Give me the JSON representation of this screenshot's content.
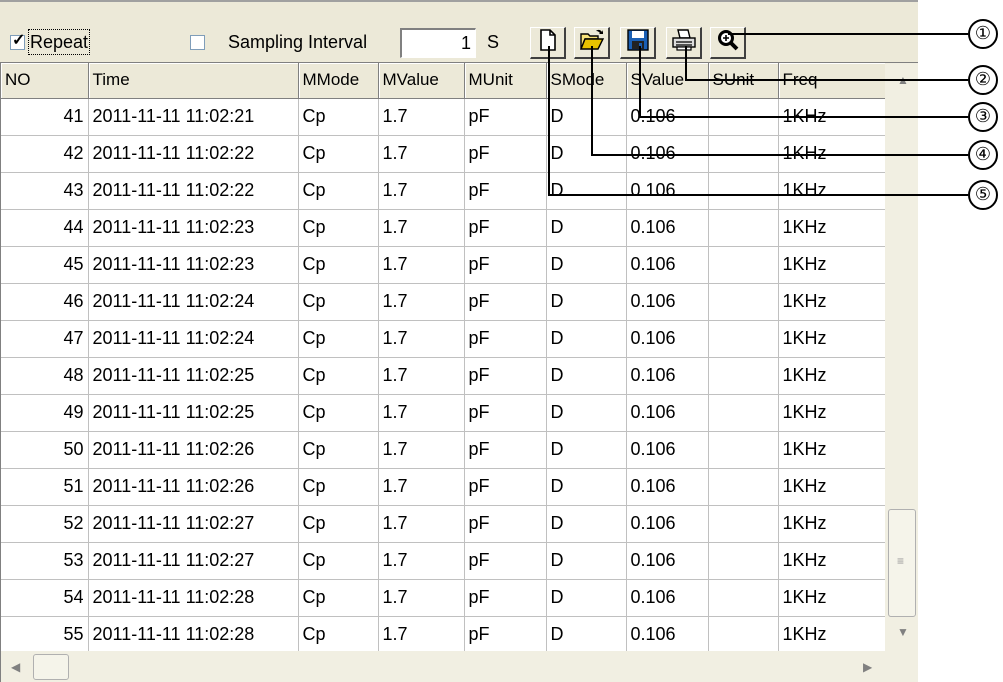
{
  "toolbar": {
    "repeat_checked": true,
    "repeat_label": "Repeat",
    "sampling_checked": false,
    "sampling_label": "Sampling Interval",
    "interval_value": "1",
    "interval_unit": "S",
    "buttons": [
      {
        "icon": "new-file-icon"
      },
      {
        "icon": "open-folder-icon"
      },
      {
        "icon": "save-disk-icon"
      },
      {
        "icon": "print-icon"
      },
      {
        "icon": "zoom-icon"
      }
    ]
  },
  "table": {
    "columns": [
      "NO",
      "Time",
      "MMode",
      "MValue",
      "MUnit",
      "SMode",
      "SValue",
      "SUnit",
      "Freq"
    ],
    "rows": [
      [
        "41",
        "2011-11-11 11:02:21",
        "Cp",
        "1.7",
        "pF",
        "D",
        "0.106",
        "",
        "1KHz"
      ],
      [
        "42",
        "2011-11-11 11:02:22",
        "Cp",
        "1.7",
        "pF",
        "D",
        "0.106",
        "",
        "1KHz"
      ],
      [
        "43",
        "2011-11-11 11:02:22",
        "Cp",
        "1.7",
        "pF",
        "D",
        "0.106",
        "",
        "1KHz"
      ],
      [
        "44",
        "2011-11-11 11:02:23",
        "Cp",
        "1.7",
        "pF",
        "D",
        "0.106",
        "",
        "1KHz"
      ],
      [
        "45",
        "2011-11-11 11:02:23",
        "Cp",
        "1.7",
        "pF",
        "D",
        "0.106",
        "",
        "1KHz"
      ],
      [
        "46",
        "2011-11-11 11:02:24",
        "Cp",
        "1.7",
        "pF",
        "D",
        "0.106",
        "",
        "1KHz"
      ],
      [
        "47",
        "2011-11-11 11:02:24",
        "Cp",
        "1.7",
        "pF",
        "D",
        "0.106",
        "",
        "1KHz"
      ],
      [
        "48",
        "2011-11-11 11:02:25",
        "Cp",
        "1.7",
        "pF",
        "D",
        "0.106",
        "",
        "1KHz"
      ],
      [
        "49",
        "2011-11-11 11:02:25",
        "Cp",
        "1.7",
        "pF",
        "D",
        "0.106",
        "",
        "1KHz"
      ],
      [
        "50",
        "2011-11-11 11:02:26",
        "Cp",
        "1.7",
        "pF",
        "D",
        "0.106",
        "",
        "1KHz"
      ],
      [
        "51",
        "2011-11-11 11:02:26",
        "Cp",
        "1.7",
        "pF",
        "D",
        "0.106",
        "",
        "1KHz"
      ],
      [
        "52",
        "2011-11-11 11:02:27",
        "Cp",
        "1.7",
        "pF",
        "D",
        "0.106",
        "",
        "1KHz"
      ],
      [
        "53",
        "2011-11-11 11:02:27",
        "Cp",
        "1.7",
        "pF",
        "D",
        "0.106",
        "",
        "1KHz"
      ],
      [
        "54",
        "2011-11-11 11:02:28",
        "Cp",
        "1.7",
        "pF",
        "D",
        "0.106",
        "",
        "1KHz"
      ],
      [
        "55",
        "2011-11-11 11:02:28",
        "Cp",
        "1.7",
        "pF",
        "D",
        "0.106",
        "",
        "1KHz"
      ]
    ]
  },
  "callouts": [
    "①",
    "②",
    "③",
    "④",
    "⑤"
  ],
  "colors": {
    "panel": "#ece9d8",
    "save_icon": "#1a5fb4",
    "folder_icon": "#e8c200"
  }
}
